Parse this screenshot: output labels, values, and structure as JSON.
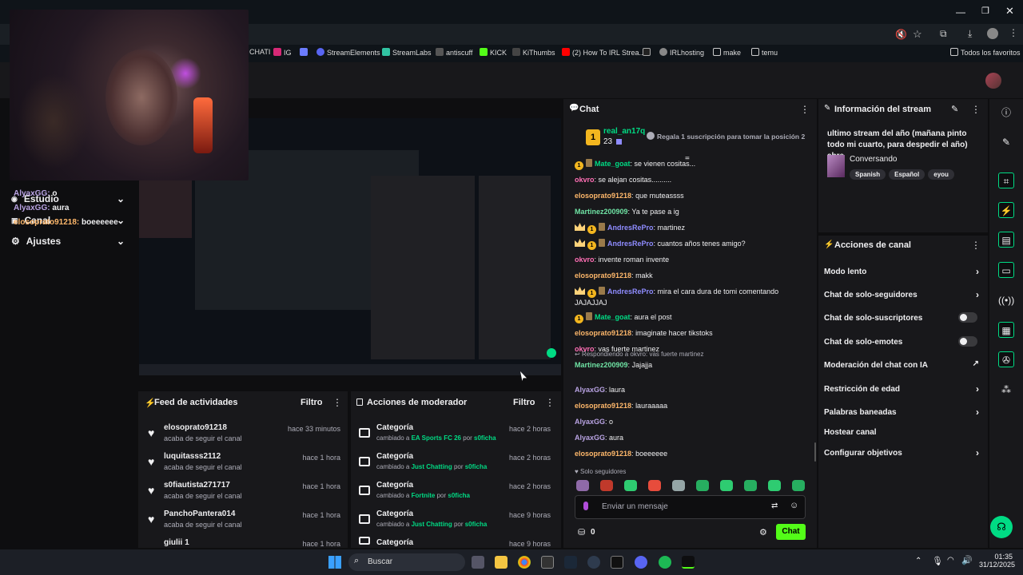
{
  "browser": {
    "bookmarks": [
      "CHATI",
      "IG",
      "StreamElements",
      "StreamLabs",
      "antiscuff",
      "KICK",
      "KiThumbs",
      "(2) How To IRL Strea...",
      "IRLhosting",
      "make",
      "temu",
      "Todos los favoritos"
    ]
  },
  "left_nav": {
    "items": [
      {
        "label": "Estudio"
      },
      {
        "label": "Canal"
      },
      {
        "label": "Ajustes"
      }
    ],
    "overlay": [
      {
        "user": "AlyaxGG:",
        "text": "o",
        "color": "#b9a3e3"
      },
      {
        "user": "AlyaxGG:",
        "text": "aura",
        "color": "#b9a3e3"
      },
      {
        "user": "elosoprato91218:",
        "text": "boeeeeee",
        "color": "#ffb86b"
      }
    ]
  },
  "activity_feed": {
    "title": "Feed de actividades",
    "filter": "Filtro",
    "items": [
      {
        "name": "elosoprato91218",
        "sub": "acaba de seguir el canal",
        "time": "hace 33 minutos"
      },
      {
        "name": "luquitasss2112",
        "sub": "acaba de seguir el canal",
        "time": "hace 1 hora"
      },
      {
        "name": "s0fiautista271717",
        "sub": "acaba de seguir el canal",
        "time": "hace 1 hora"
      },
      {
        "name": "PanchoPantera014",
        "sub": "acaba de seguir el canal",
        "time": "hace 1 hora"
      },
      {
        "name": "giulii 1",
        "sub": "",
        "time": "hace 1 hora"
      }
    ]
  },
  "mod_actions": {
    "title": "Acciones de moderador",
    "filter": "Filtro",
    "items": [
      {
        "name": "Categoría",
        "pre": "cambiado a",
        "value": "EA Sports FC 26",
        "by": "por",
        "mod": "s0ficha",
        "time": "hace 2 horas"
      },
      {
        "name": "Categoría",
        "pre": "cambiado a",
        "value": "Just Chatting",
        "by": "por",
        "mod": "s0ficha",
        "time": "hace 2 horas"
      },
      {
        "name": "Categoría",
        "pre": "cambiado a",
        "value": "Fortnite",
        "by": "por",
        "mod": "s0ficha",
        "time": "hace 2 horas"
      },
      {
        "name": "Categoría",
        "pre": "cambiado a",
        "value": "Just Chatting",
        "by": "por",
        "mod": "s0ficha",
        "time": "hace 9 horas"
      },
      {
        "name": "Categoría",
        "pre": "",
        "value": "",
        "by": "",
        "mod": "",
        "time": "hace 9 horas"
      }
    ]
  },
  "chat": {
    "title": "Chat",
    "top_gifter": {
      "name": "real_an17q",
      "count": "23",
      "rank": "1",
      "promo": "Regala 1 suscripción para tomar la posición 2"
    },
    "messages": [
      {
        "user": "Mate_goat",
        "text": "se vienen cositas...",
        "color": "#00db84",
        "badges": "coin"
      },
      {
        "user": "okvro",
        "text": "se alejan cositas..........",
        "color": "#ff6fb5",
        "badges": ""
      },
      {
        "user": "elosoprato91218",
        "text": "que muteassss",
        "color": "#ffb86b",
        "badges": ""
      },
      {
        "user": "Martinez200909",
        "text": "Ya te pase a ig",
        "color": "#6fe3a4",
        "badges": ""
      },
      {
        "user": "AndresRePro",
        "text": "martinez",
        "color": "#8f8cff",
        "badges": "crown"
      },
      {
        "user": "AndresRePro",
        "text": "cuantos años tenes amigo?",
        "color": "#8f8cff",
        "badges": "crown"
      },
      {
        "user": "okvro",
        "text": "invente roman invente",
        "color": "#ff6fb5",
        "badges": ""
      },
      {
        "user": "elosoprato91218",
        "text": "makk",
        "color": "#ffb86b",
        "badges": ""
      },
      {
        "user": "AndresRePro",
        "text": "mira el cara dura de tomi comentando JAJAJJAJ",
        "color": "#8f8cff",
        "badges": "crown"
      },
      {
        "user": "Mate_goat",
        "text": "aura el post",
        "color": "#00db84",
        "badges": "coin"
      },
      {
        "user": "elosoprato91218",
        "text": "imaginate hacer tikstoks",
        "color": "#ffb86b",
        "badges": ""
      },
      {
        "user": "okvro",
        "text": "vas fuerte martinez",
        "color": "#ff6fb5",
        "badges": ""
      },
      {
        "user": "Martinez200909",
        "text": "Jajajja",
        "color": "#6fe3a4",
        "badges": "",
        "reply": "Respondiendo a okvro: vas fuerte martinez"
      },
      {
        "user": "AlyaxGG",
        "text": "laura",
        "color": "#b9a3e3",
        "badges": ""
      },
      {
        "user": "elosoprato91218",
        "text": "lauraaaaa",
        "color": "#ffb86b",
        "badges": ""
      },
      {
        "user": "AlyaxGG",
        "text": "o",
        "color": "#b9a3e3",
        "badges": ""
      },
      {
        "user": "AlyaxGG",
        "text": "aura",
        "color": "#b9a3e3",
        "badges": ""
      },
      {
        "user": "elosoprato91218",
        "text": "boeeeeee",
        "color": "#ffb86b",
        "badges": ""
      }
    ],
    "mode_label": "Solo seguidores",
    "input_placeholder": "Enviar un mensaje",
    "points": "0",
    "send_label": "Chat"
  },
  "stream_info": {
    "title": "Información del stream",
    "stream_title": "ultimo stream del año (mañana pinto todo mi cuarto, para despedir el año) ahre",
    "category": "Conversando",
    "tags": [
      "Spanish",
      "Español",
      "eyou"
    ]
  },
  "channel_actions": {
    "title": "Acciones de canal",
    "items": [
      {
        "label": "Modo lento",
        "control": "chevron"
      },
      {
        "label": "Chat de solo-seguidores",
        "control": "chevron"
      },
      {
        "label": "Chat de solo-suscriptores",
        "control": "toggle"
      },
      {
        "label": "Chat de solo-emotes",
        "control": "toggle"
      },
      {
        "label": "Moderación del chat con IA",
        "control": "external"
      },
      {
        "label": "Restricción de edad",
        "control": "chevron"
      },
      {
        "label": "Palabras baneadas",
        "control": "chevron"
      },
      {
        "label": "Hostear canal",
        "control": "none"
      },
      {
        "label": "Configurar objetivos",
        "control": "chevron"
      }
    ]
  },
  "taskbar": {
    "search": "Buscar",
    "time": "01:35",
    "date": "31/12/2025"
  },
  "colors": {
    "accent": "#00db84",
    "bg": "#0e0e10",
    "panel": "#18181b",
    "brand": "#53fc18"
  }
}
